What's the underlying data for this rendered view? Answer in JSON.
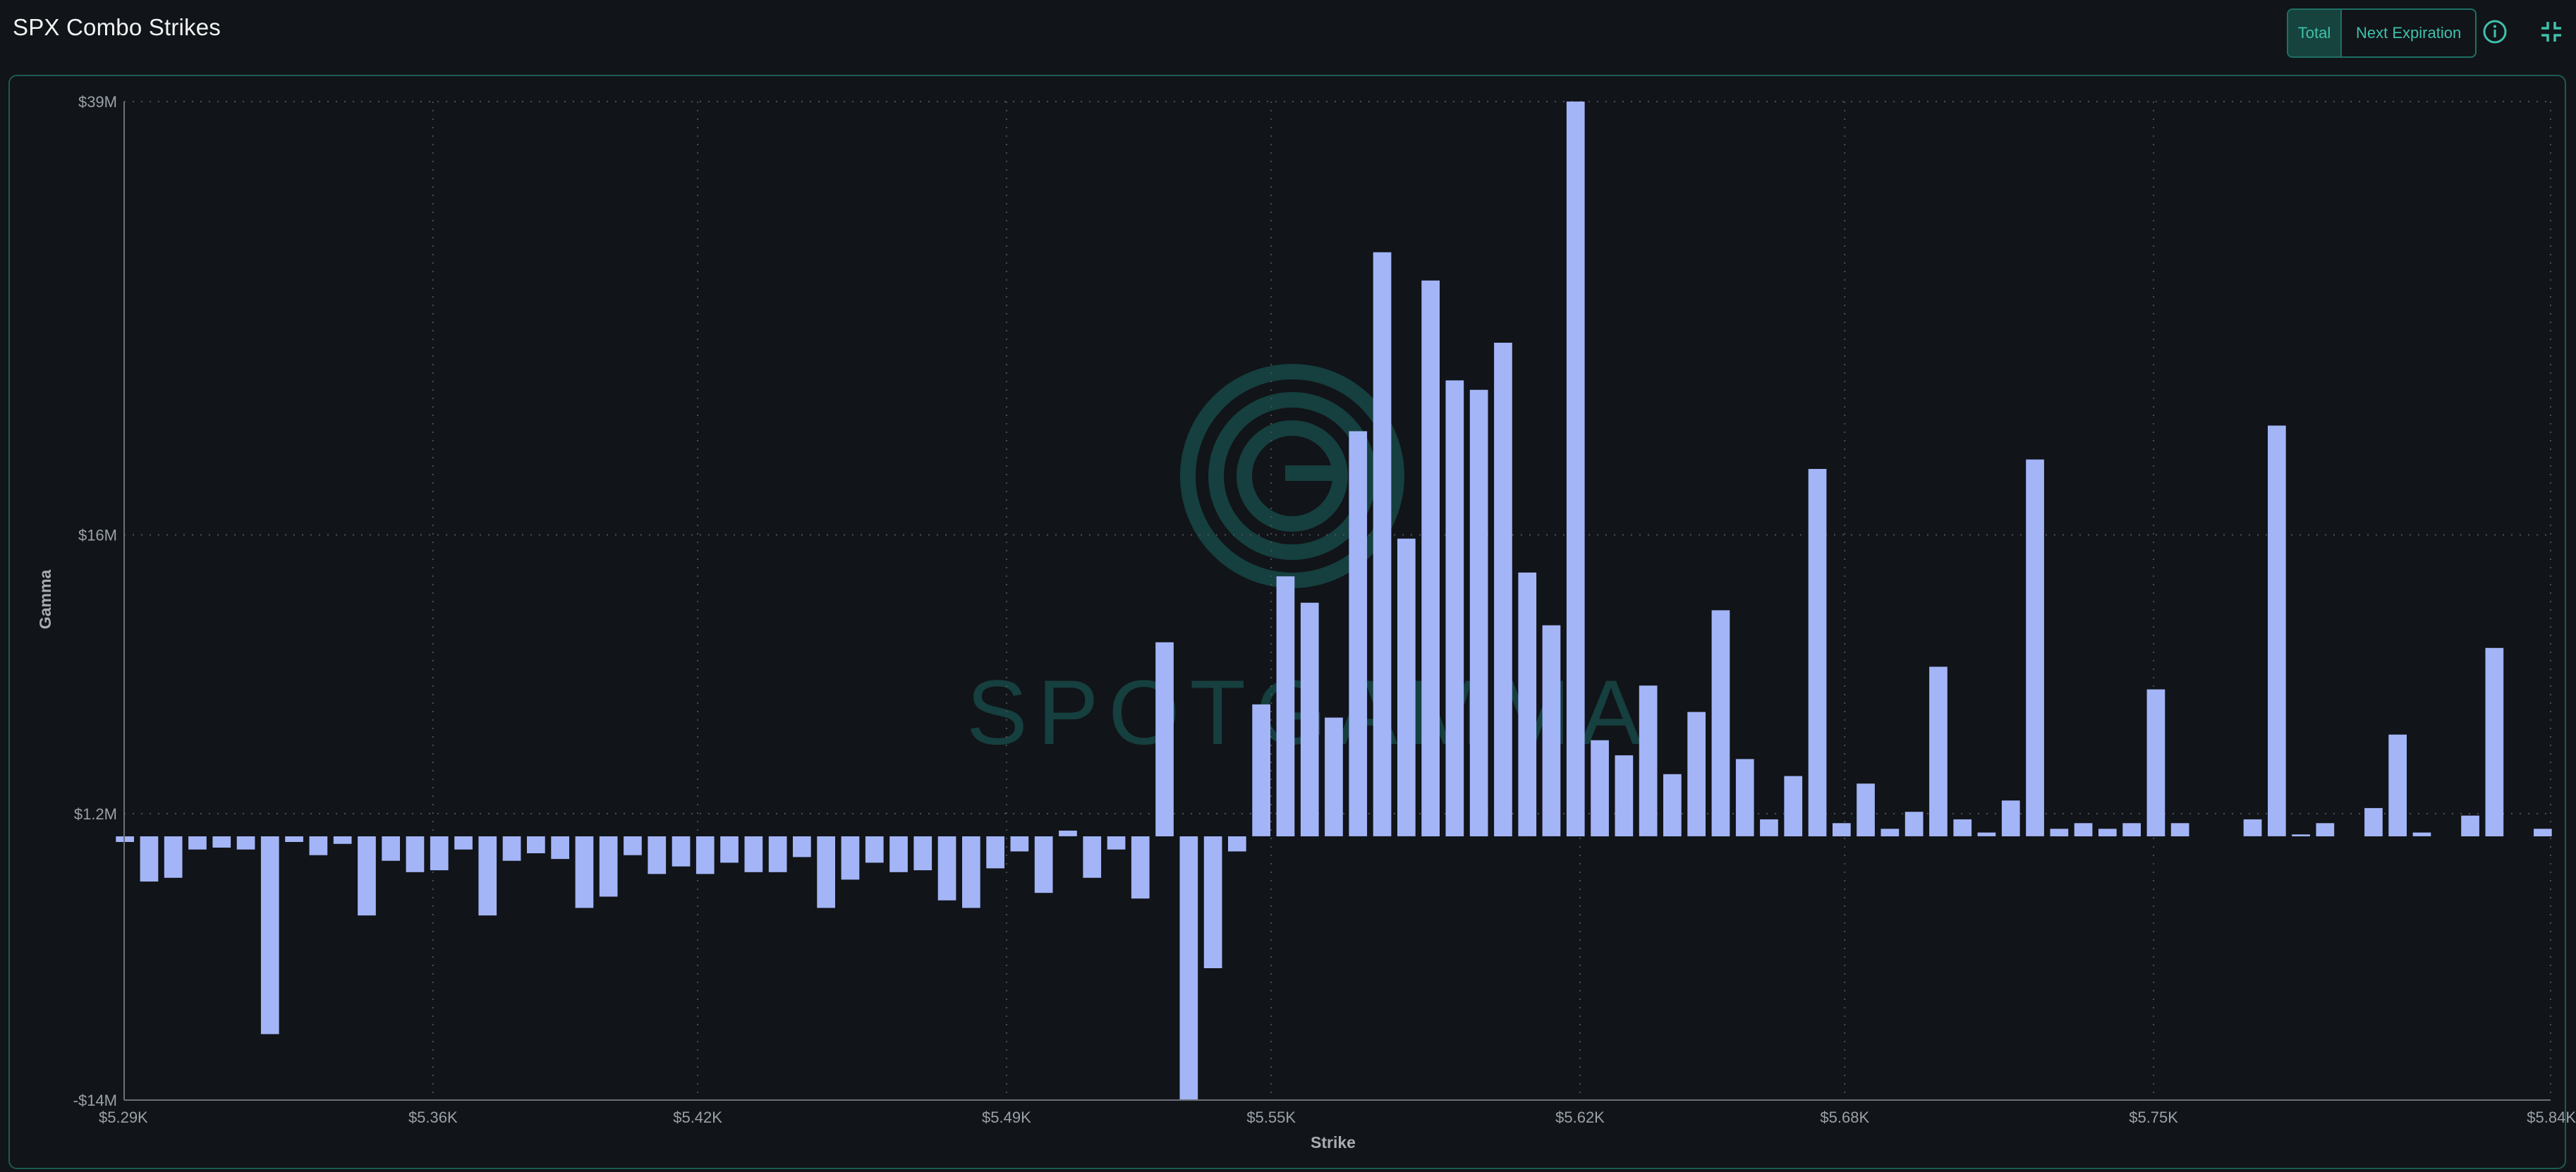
{
  "header": {
    "title": "SPX Combo Strikes",
    "toggle_total": "Total",
    "toggle_next_expiration": "Next Expiration",
    "info_icon": "info-icon",
    "collapse_icon": "collapse-icon"
  },
  "colors": {
    "background": "#111418",
    "bar": "#a3b5f7",
    "accent": "#3fc1ad",
    "grid": "#4a5058"
  },
  "watermark": "SPOTGAMMA",
  "chart_data": {
    "type": "bar",
    "xlabel": "Strike",
    "ylabel": "Gamma",
    "x_tick_labels": [
      "$5.29K",
      "$5.36K",
      "$5.42K",
      "$5.49K",
      "$5.55K",
      "$5.62K",
      "$5.68K",
      "$5.75K",
      "$5.84K"
    ],
    "x_tick_values": [
      5290,
      5360,
      5420,
      5490,
      5550,
      5620,
      5680,
      5750,
      5840
    ],
    "y_tick_labels": [
      "$39M",
      "$16M",
      "$1.2M",
      "-$14M"
    ],
    "y_tick_values": [
      39,
      16,
      1.2,
      -14
    ],
    "ylim": [
      -14,
      39
    ],
    "y_units": "$M",
    "grid": true,
    "series": [
      {
        "values": [
          -0.3,
          -2.4,
          -2.2,
          -0.7,
          -0.6,
          -0.7,
          -10.5,
          -0.3,
          -1.0,
          -0.4,
          -4.2,
          -1.3,
          -1.9,
          -1.8,
          -0.7,
          -4.2,
          -1.3,
          -0.9,
          -1.2,
          -3.8,
          -3.2,
          -1.0,
          -2.0,
          -1.6,
          -2.0,
          -1.4,
          -1.9,
          -1.9,
          -1.1,
          -3.8,
          -2.3,
          -1.4,
          -1.9,
          -1.8,
          -3.4,
          -3.8,
          -1.7,
          -0.8,
          -3.0,
          0.3,
          -2.2,
          -0.7,
          -3.3,
          10.3,
          -14.0,
          -7.0,
          -0.8,
          7.0,
          13.8,
          12.4,
          6.3,
          21.5,
          31.0,
          15.8,
          29.5,
          24.2,
          23.7,
          26.2,
          14.0,
          11.2,
          39.0,
          5.1,
          4.3,
          8.0,
          3.3,
          6.6,
          12.0,
          4.1,
          0.9,
          3.2,
          19.5,
          0.7,
          2.8,
          0.4,
          1.3,
          9.0,
          0.9,
          0.2,
          1.9,
          20.0,
          0.4,
          0.7,
          0.4,
          0.7,
          7.8,
          0.7,
          0.0,
          0.0,
          0.9,
          21.8,
          0.1,
          0.7,
          0.0,
          1.5,
          5.4,
          0.2,
          0.0,
          1.1,
          10.0,
          0.0,
          0.4
        ]
      }
    ]
  }
}
